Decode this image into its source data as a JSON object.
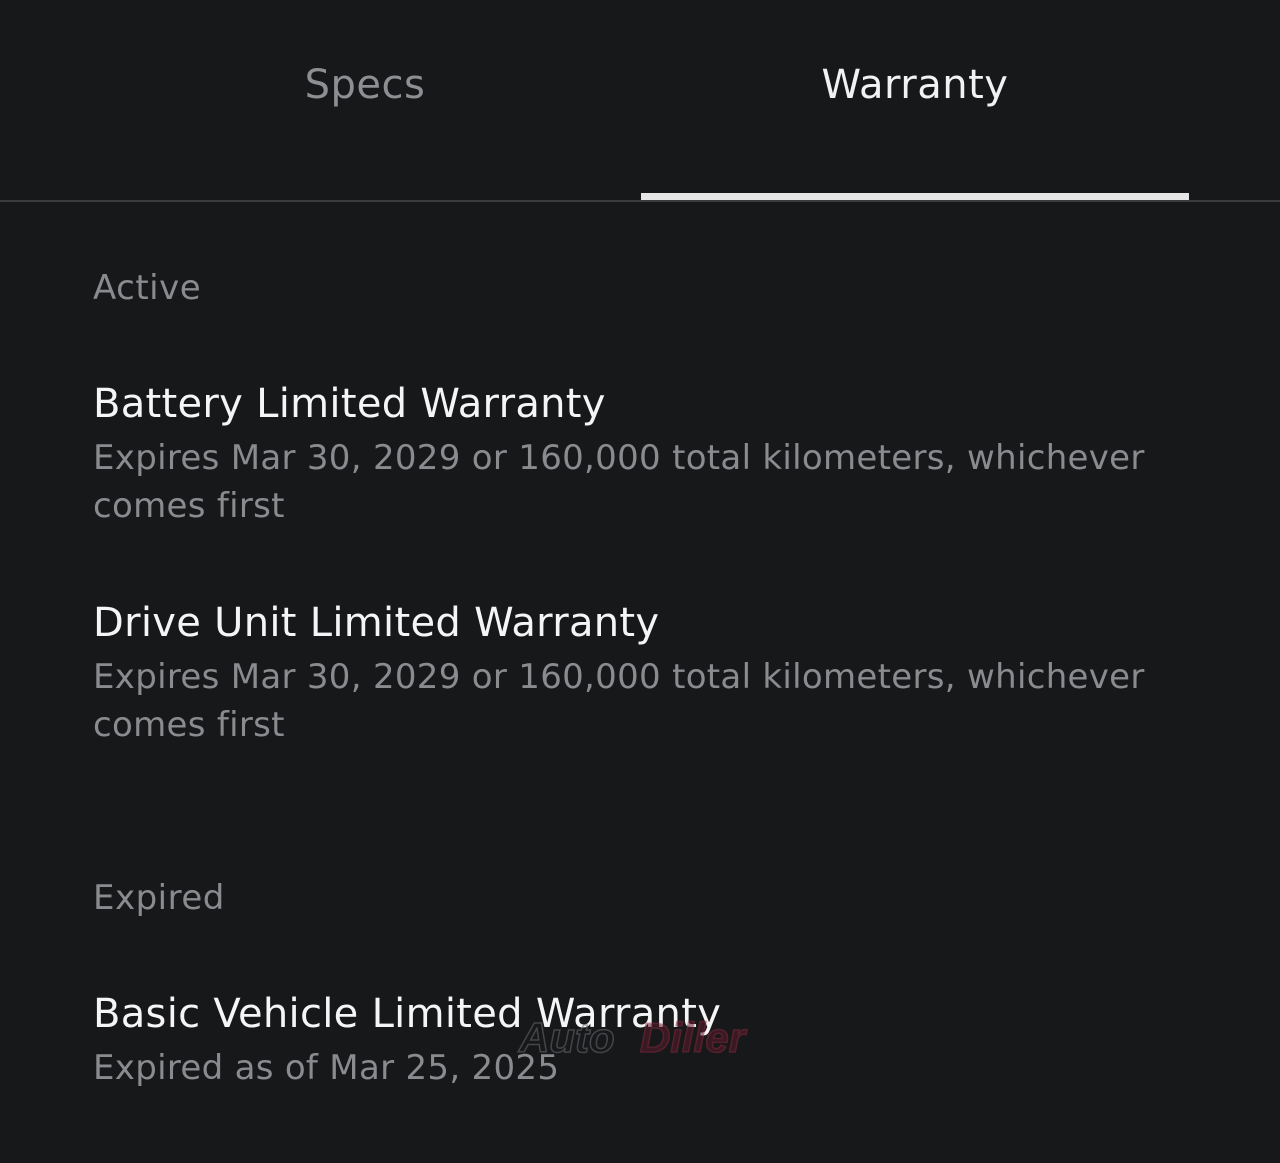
{
  "tabs": {
    "specs_label": "Specs",
    "warranty_label": "Warranty",
    "active_tab": "Warranty"
  },
  "sections": {
    "active_label": "Active",
    "expired_label": "Expired"
  },
  "active_items": [
    {
      "title": "Battery Limited Warranty",
      "description": "Expires Mar 30, 2029 or 160,000 total kilometers, whichever comes first"
    },
    {
      "title": "Drive Unit Limited Warranty",
      "description": "Expires Mar 30, 2029 or 160,000 total kilometers, whichever comes first"
    }
  ],
  "expired_items": [
    {
      "title": "Basic Vehicle Limited Warranty",
      "description": "Expired as of Mar 25, 2025"
    }
  ],
  "watermark": {
    "text_part1": "Auto",
    "text_part2": "Diller"
  },
  "colors": {
    "background": "#17181a",
    "active_text": "#f2f2f2",
    "inactive_text": "#8e8f93",
    "indicator": "#e6e6e6"
  }
}
